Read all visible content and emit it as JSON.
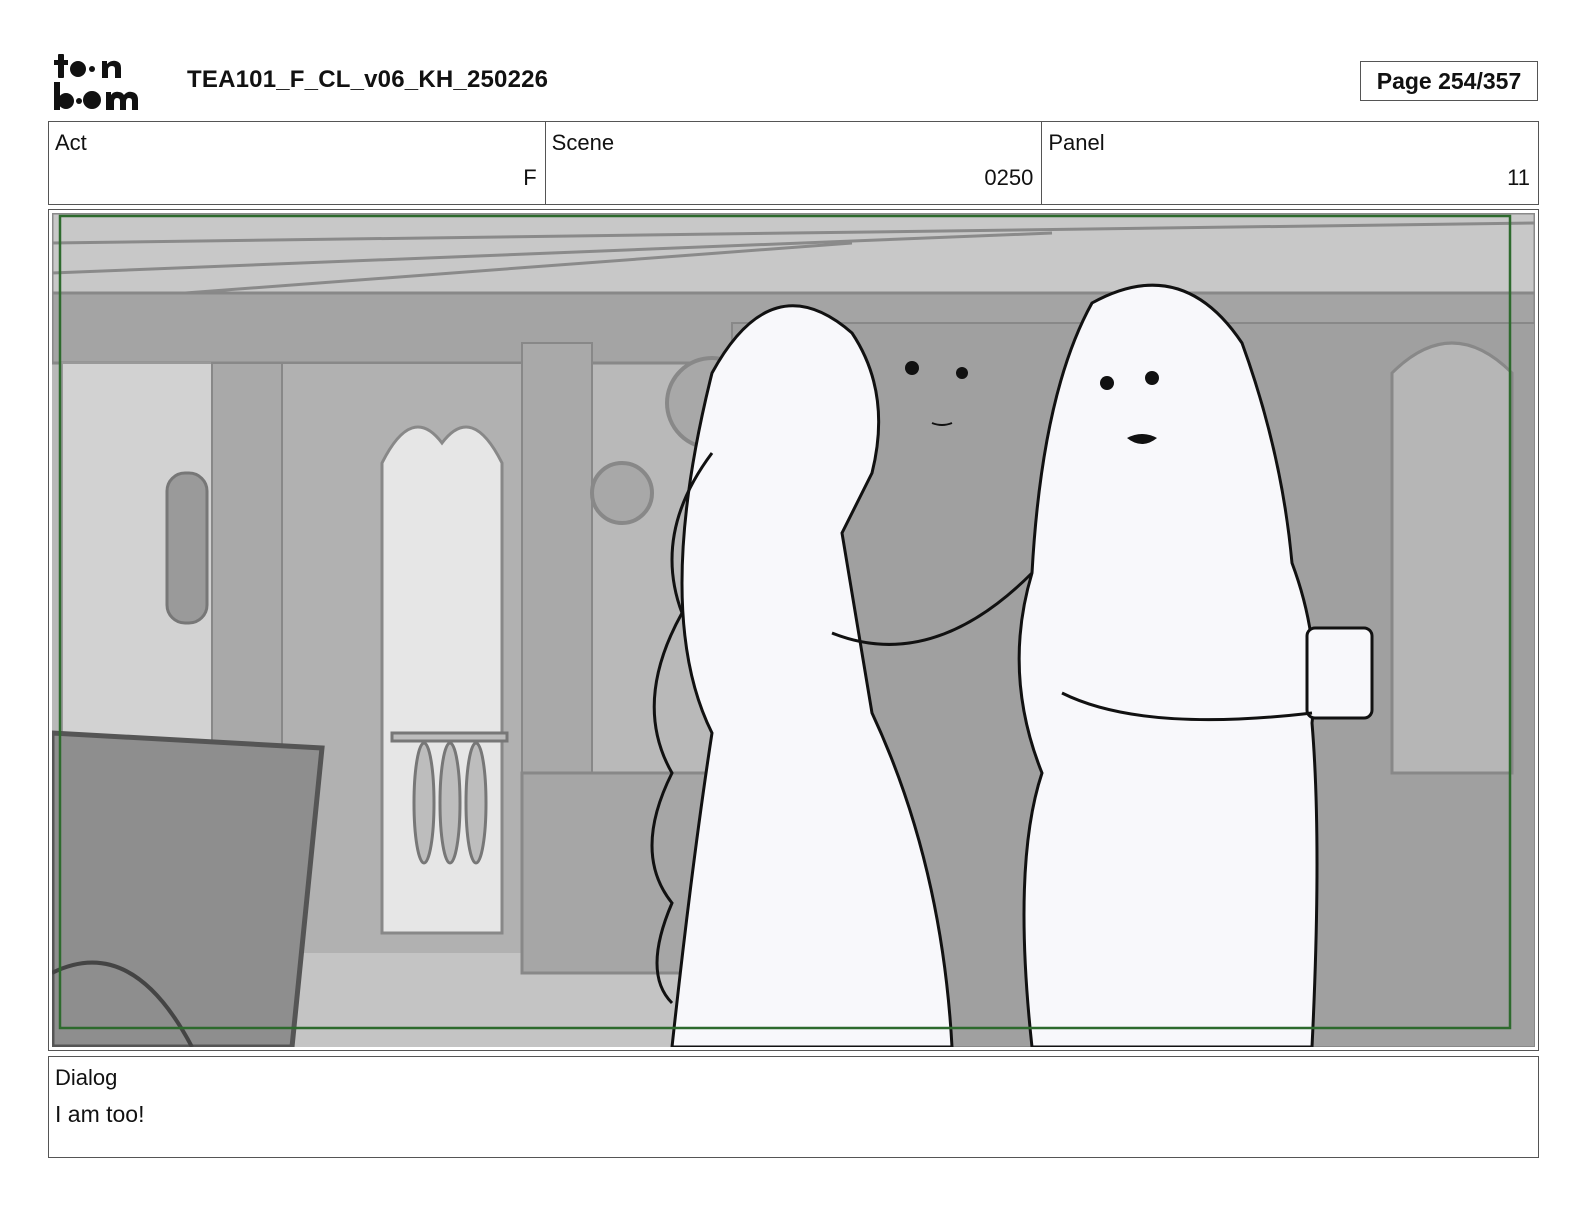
{
  "header": {
    "logo_text": "toon boom",
    "document_title": "TEA101_F_CL_v06_KH_250226",
    "page_indicator": "Page 254/357"
  },
  "info": {
    "act": {
      "label": "Act",
      "value": "F"
    },
    "scene": {
      "label": "Scene",
      "value": "0250"
    },
    "panel": {
      "label": "Panel",
      "value": "11"
    }
  },
  "panel_image": {
    "description_icon": "storyboard-drawing",
    "safe_frame_color": "#2d6a2d"
  },
  "dialog": {
    "label": "Dialog",
    "text": "I am too!"
  }
}
